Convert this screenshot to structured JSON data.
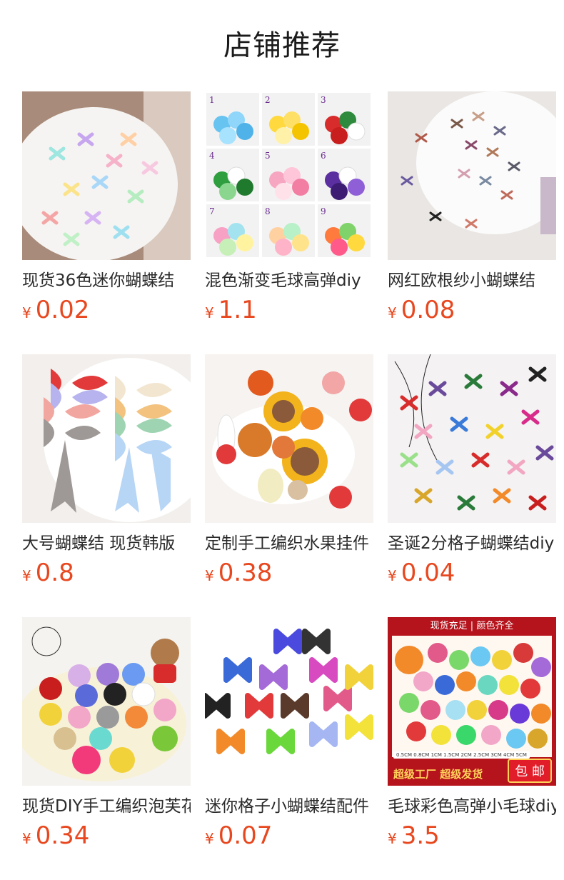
{
  "header": {
    "title": "店铺推荐"
  },
  "products": [
    {
      "name": "现货36色迷你蝴蝶结",
      "currency": "¥",
      "price": "0.02",
      "image_icon": "ribbon-bows-plate-image"
    },
    {
      "name": "混色渐变毛球高弹diy",
      "currency": "¥",
      "price": "1.1",
      "image_icon": "pompom-color-grid-image"
    },
    {
      "name": "网红欧根纱小蝴蝶结",
      "currency": "¥",
      "price": "0.08",
      "image_icon": "organza-bows-plate-image"
    },
    {
      "name": "大号蝴蝶结 现货韩版",
      "currency": "¥",
      "price": "0.8",
      "image_icon": "large-satin-bows-image"
    },
    {
      "name": "定制手工编织水果挂件",
      "currency": "¥",
      "price": "0.38",
      "image_icon": "crochet-fruit-image"
    },
    {
      "name": "圣诞2分格子蝴蝶结diy",
      "currency": "¥",
      "price": "0.04",
      "image_icon": "gingham-bows-pile-image"
    },
    {
      "name": "现货DIY手工编织泡芙花",
      "currency": "¥",
      "price": "0.34",
      "image_icon": "crochet-flowers-image"
    },
    {
      "name": "迷你格子小蝴蝶结配件",
      "currency": "¥",
      "price": "0.07",
      "image_icon": "mini-plaid-bows-image"
    },
    {
      "name": "毛球彩色高弹小毛球diy",
      "currency": "¥",
      "price": "3.5",
      "image_icon": "colorful-pompoms-image"
    }
  ],
  "product9_badges": {
    "top_left": "现货充足",
    "top_right": "颜色齐全",
    "sizes": "0.5CM 0.8CM 1CM 1.5CM 2CM 2.5CM 3CM 4CM 5CM",
    "bottom_left": "超级工厂 超级发货",
    "bottom_right": "包 邮"
  },
  "product2_numbers": [
    "1",
    "2",
    "3",
    "4",
    "5",
    "6",
    "7",
    "8",
    "9"
  ],
  "colors": {
    "price": "#e8481f",
    "title": "#1a1a1a",
    "name": "#2b2b2b",
    "badge_red": "#b6141c"
  }
}
